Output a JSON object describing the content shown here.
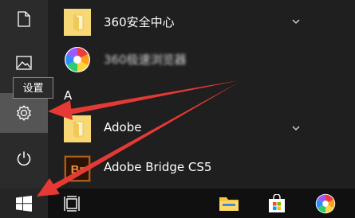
{
  "tooltip": {
    "text": "设置"
  },
  "rail": {
    "items": [
      {
        "name": "documents",
        "icon": "document-icon"
      },
      {
        "name": "pictures",
        "icon": "pictures-icon"
      },
      {
        "name": "settings",
        "icon": "gear-icon"
      },
      {
        "name": "power",
        "icon": "power-icon"
      }
    ]
  },
  "apps": {
    "section_letter": "A",
    "items": [
      {
        "label": "360安全中心",
        "icon": "folder-icon",
        "expandable": true
      },
      {
        "label": "360极速浏览器",
        "icon": "360-browser-icon",
        "expandable": false
      },
      {
        "label": "Adobe",
        "icon": "folder-icon",
        "expandable": true
      },
      {
        "label": "Adobe Bridge CS5",
        "icon": "adobe-bridge-icon",
        "expandable": false
      }
    ]
  },
  "taskbar": {
    "items": [
      {
        "name": "start",
        "icon": "windows-logo-icon"
      },
      {
        "name": "task-view",
        "icon": "task-view-icon"
      },
      {
        "name": "file-explorer",
        "icon": "folder-icon"
      },
      {
        "name": "store",
        "icon": "store-icon"
      },
      {
        "name": "360-browser",
        "icon": "360-browser-icon"
      }
    ]
  },
  "colors": {
    "rail_bg": "#2b2b2b",
    "list_bg": "#1f1f1f",
    "taskbar_bg": "#101010",
    "folder_yellow": "#f8d775",
    "arrow_red": "#e53935"
  }
}
